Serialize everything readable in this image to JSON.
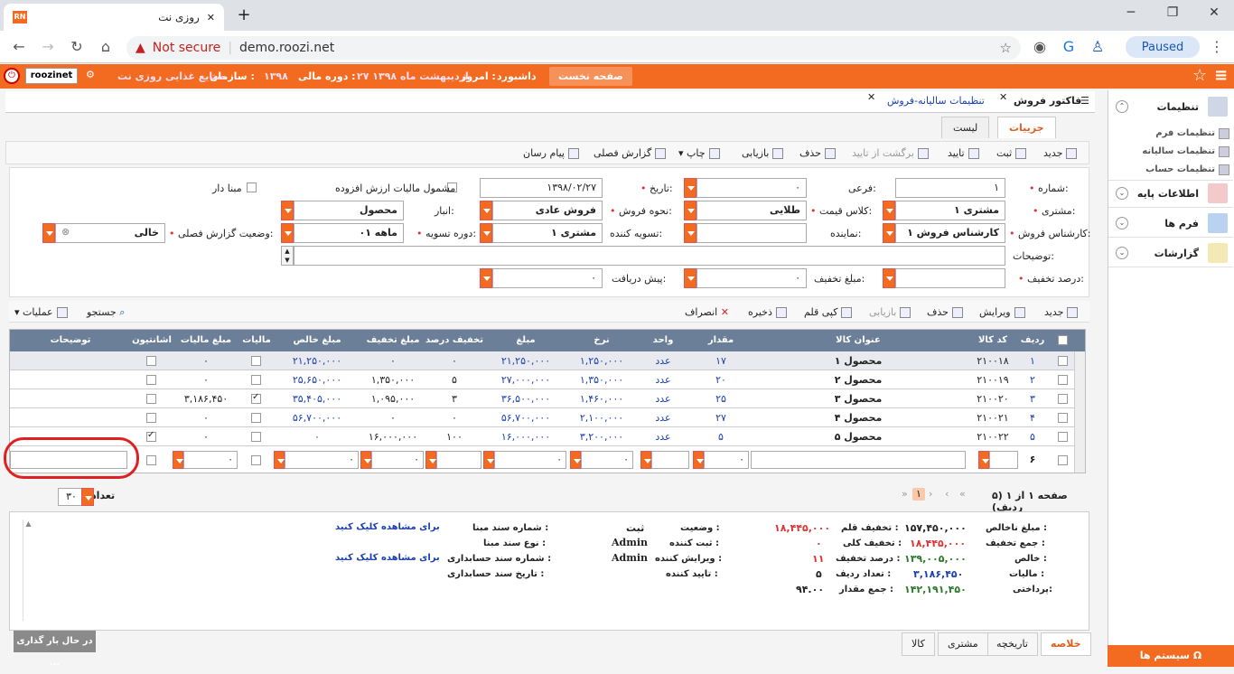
{
  "browser": {
    "tab_title": "روزی نت",
    "favicon": "RN",
    "url_warning": "Not secure",
    "url": "demo.roozi.net",
    "paused": "Paused"
  },
  "topbar": {
    "home": "صفحه نخست",
    "dashboard": "داشبورد",
    "today_label": "امروز :",
    "today": "۲۷ اردیبهشت ماه ۱۳۹۸",
    "fiscal_label": "دوره مالی :",
    "fiscal": "۱۳۹۸",
    "org_label": "سازمان :",
    "org": "صنایع غذایی روزی نت",
    "user": "roozinet"
  },
  "sidebar": {
    "settings": "تنظیمات",
    "sub": [
      "تنظیمات فرم",
      "تنظیمات سالیانه",
      "تنظیمات حساب"
    ],
    "base": "اطلاعات پایه",
    "forms": "فرم ها",
    "reports": "گزارشات",
    "system": "سیستم ها"
  },
  "doctabs": [
    "فاکتور فروش",
    "تنظیمات سالیانه-فروش"
  ],
  "subtabs": {
    "details": "جزییات",
    "list": "لیست"
  },
  "toolbar1": [
    "جدید",
    "ثبت",
    "تایید",
    "برگشت از تایید",
    "حذف",
    "بازیابی",
    "چاپ",
    "گزارش فصلی",
    "پیام رسان"
  ],
  "form": {
    "number_label": "شماره:",
    "number": "۱",
    "sub_label": "فرعی:",
    "sub": "۰",
    "date_label": "تاریخ:",
    "date": "۱۳۹۸/۰۲/۲۷",
    "vat_label": "مشمول مالیات ارزش افزوده",
    "mabna_label": "مبنا دار",
    "customer_label": "مشتری:",
    "customer": "مشتری ۱",
    "price_class_label": "کلاس قیمت:",
    "price_class": "طلایی",
    "sale_type_label": "نحوه فروش:",
    "sale_type": "فروش عادی",
    "warehouse_label": "انبار:",
    "warehouse": "محصول",
    "season_label": "وضعیت گزارش فصلی:",
    "season": "خالی",
    "expert_label": "کارشناس فروش:",
    "expert": "کارشناس فروش ۱",
    "rep_label": "نماینده:",
    "rep": "",
    "settler_label": "تسویه کننده:",
    "settler": "مشتری ۱",
    "period_label": "دوره تسویه:",
    "period": "۰۱ ماهه",
    "desc_label": "توضیحات:",
    "discount_pct_label": "درصد تخفیف:",
    "discount_pct": "",
    "discount_amt_label": "مبلغ تخفیف:",
    "discount_amt": "۰",
    "prepay_label": "پیش دریافت:",
    "prepay": "۰"
  },
  "toolbar2": {
    "new": "جدید",
    "edit": "ویرایش",
    "delete": "حذف",
    "restore": "بازیابی",
    "copy": "کپی قلم",
    "save": "ذخیره",
    "cancel": "انصراف",
    "search": "جستجو",
    "ops": "عملیات"
  },
  "grid": {
    "headers": [
      "ردیف",
      "کد کالا",
      "عنوان کالا",
      "مقدار",
      "واحد",
      "نرخ",
      "مبلغ",
      "تخفیف درصد",
      "مبلغ تخفیف",
      "مبلغ خالص",
      "مالیات",
      "مبلغ مالیات",
      "اشانتیون",
      "توضیحات"
    ],
    "rows": [
      {
        "row": "۱",
        "code": "۲۱۰۰۱۸",
        "title": "محصول ۱",
        "qty": "۱۷",
        "unit": "عدد",
        "rate": "۱,۲۵۰,۰۰۰",
        "amount": "۲۱,۲۵۰,۰۰۰",
        "disc_pct": "۰",
        "disc_amt": "۰",
        "net": "۲۱,۲۵۰,۰۰۰",
        "tax": false,
        "tax_amt": "۰",
        "gift": false
      },
      {
        "row": "۲",
        "code": "۲۱۰۰۱۹",
        "title": "محصول ۲",
        "qty": "۲۰",
        "unit": "عدد",
        "rate": "۱,۳۵۰,۰۰۰",
        "amount": "۲۷,۰۰۰,۰۰۰",
        "disc_pct": "۵",
        "disc_amt": "۱,۳۵۰,۰۰۰",
        "net": "۲۵,۶۵۰,۰۰۰",
        "tax": false,
        "tax_amt": "۰",
        "gift": false
      },
      {
        "row": "۳",
        "code": "۲۱۰۰۲۰",
        "title": "محصول ۳",
        "qty": "۲۵",
        "unit": "عدد",
        "rate": "۱,۴۶۰,۰۰۰",
        "amount": "۳۶,۵۰۰,۰۰۰",
        "disc_pct": "۳",
        "disc_amt": "۱,۰۹۵,۰۰۰",
        "net": "۳۵,۴۰۵,۰۰۰",
        "tax": true,
        "tax_amt": "۳,۱۸۶,۴۵۰",
        "gift": false
      },
      {
        "row": "۴",
        "code": "۲۱۰۰۲۱",
        "title": "محصول ۴",
        "qty": "۲۷",
        "unit": "عدد",
        "rate": "۲,۱۰۰,۰۰۰",
        "amount": "۵۶,۷۰۰,۰۰۰",
        "disc_pct": "۰",
        "disc_amt": "۰",
        "net": "۵۶,۷۰۰,۰۰۰",
        "tax": false,
        "tax_amt": "۰",
        "gift": false
      },
      {
        "row": "۵",
        "code": "۲۱۰۰۲۲",
        "title": "محصول ۵",
        "qty": "۵",
        "unit": "عدد",
        "rate": "۳,۲۰۰,۰۰۰",
        "amount": "۱۶,۰۰۰,۰۰۰",
        "disc_pct": "۱۰۰",
        "disc_amt": "۱۶,۰۰۰,۰۰۰",
        "net": "۰",
        "tax": false,
        "tax_amt": "۰",
        "gift": true
      }
    ],
    "new_row": "۶",
    "zero": "۰"
  },
  "pager": {
    "text": "صفحه ۱ از ۱ (۵ ردیف)",
    "current": "۱",
    "page_size": "۳۰",
    "page_size_label": "تعداد ردیف"
  },
  "summary": {
    "gross_label": "مبلغ ناخالص :",
    "gross": "۱۵۷,۴۵۰,۰۰۰",
    "total_disc_label": "جمع تخفیف :",
    "total_disc": "۱۸,۴۴۵,۰۰۰",
    "net_label": "خالص :",
    "net": "۱۳۹,۰۰۵,۰۰۰",
    "tax_label": "مالیات :",
    "tax": "۳,۱۸۶,۴۵۰",
    "pay_label": "پرداختی:",
    "pay": "۱۴۲,۱۹۱,۴۵۰",
    "item_disc_label": "تخفیف قلم :",
    "item_disc": "۱۸,۴۴۵,۰۰۰",
    "overall_disc_label": "تخفیف کلی :",
    "overall_disc": "۰",
    "disc_pct_label": "درصد تخفیف :",
    "disc_pct": "۱۱",
    "row_count_label": "تعداد ردیف :",
    "row_count": "۵",
    "qty_sum_label": "جمع مقدار :",
    "qty_sum": "۹۴.۰۰",
    "status_label": "وضعیت :",
    "status": "ثبت",
    "creator_label": "ثبت کننده :",
    "creator": "Admin",
    "editor_label": "ویرایش کننده :",
    "editor": "Admin",
    "approver_label": "تایید کننده :",
    "approver": "",
    "src_doc_label": "شماره سند مبنا :",
    "src_doc": "برای مشاهده کلیک کنید",
    "src_type_label": "نوع سند مبنا :",
    "src_type": "",
    "acc_doc_label": "شماره سند حسابداری :",
    "acc_doc": "برای مشاهده کلیک کنید",
    "acc_date_label": "تاریخ سند حسابداری :",
    "acc_date": ""
  },
  "bottom_tabs": [
    "خلاصه",
    "تاریخچه",
    "مشتری",
    "کالا"
  ],
  "loading": "در حال بار گذاری ..."
}
